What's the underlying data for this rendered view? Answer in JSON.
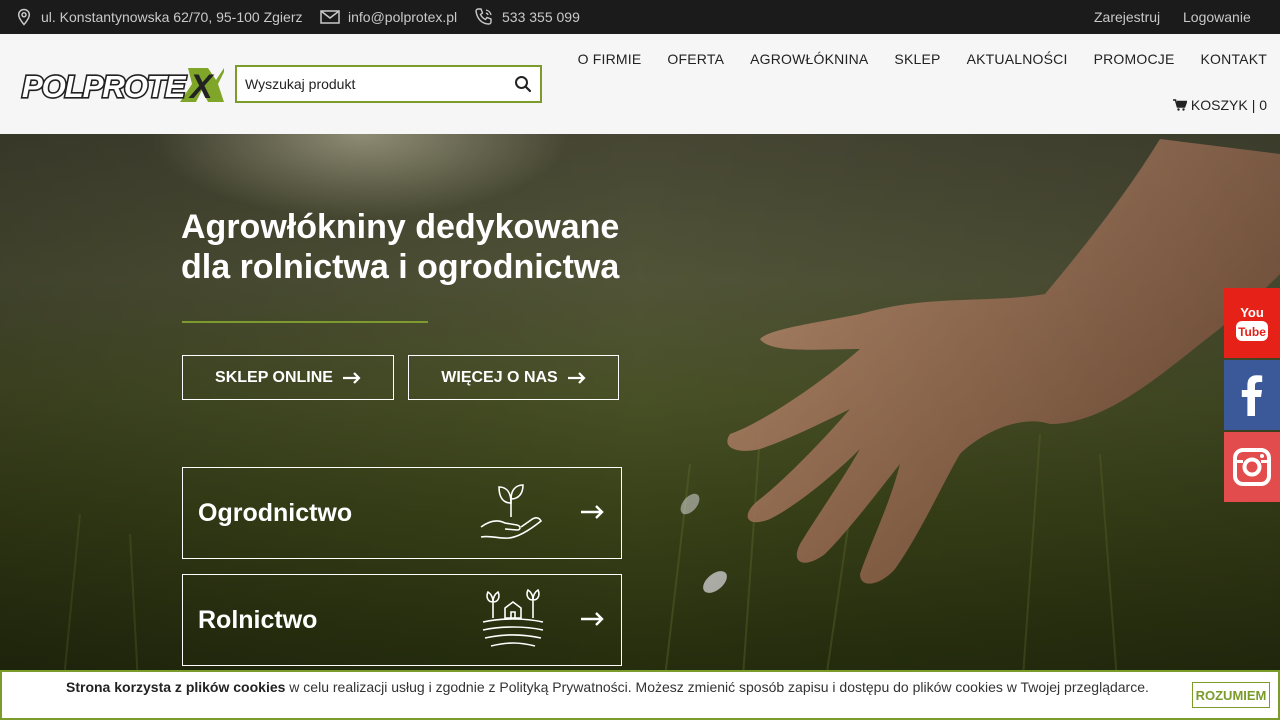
{
  "topbar": {
    "address": "ul. Konstantynowska 62/70, 95-100 Zgierz",
    "email": "info@polprotex.pl",
    "phone": "533 355 099",
    "register": "Zarejestruj",
    "login": "Logowanie"
  },
  "header": {
    "logo_text": "POLPROTEX",
    "search_placeholder": "Wyszukaj produkt",
    "nav": [
      "O FIRMIE",
      "OFERTA",
      "AGROWŁÓKNINA",
      "SKLEP",
      "AKTUALNOŚCI",
      "PROMOCJE",
      "KONTAKT"
    ],
    "cart_label": "KOSZYK",
    "cart_count": "| 0"
  },
  "hero": {
    "title_line1": "Agrowłókniny dedykowane",
    "title_line2": "dla rolnictwa i ogrodnictwa",
    "btn_shop": "SKLEP ONLINE",
    "btn_about": "WIĘCEJ O NAS",
    "card_garden": "Ogrodnictwo",
    "card_farm": "Rolnictwo"
  },
  "social": {
    "youtube_text": "You Tube"
  },
  "cookie": {
    "bold": "Strona korzysta z plików cookies",
    "text": " w celu realizacji usług i zgodnie z Polityką Prywatności. Możesz zmienić sposób zapisu i dostępu do plików cookies w Twojej przeglądarce.",
    "button": "ROZUMIEM"
  },
  "colors": {
    "accent": "#7b9b2a",
    "youtube": "#e62117",
    "facebook": "#3b5998",
    "instagram": "#e34c4c"
  }
}
